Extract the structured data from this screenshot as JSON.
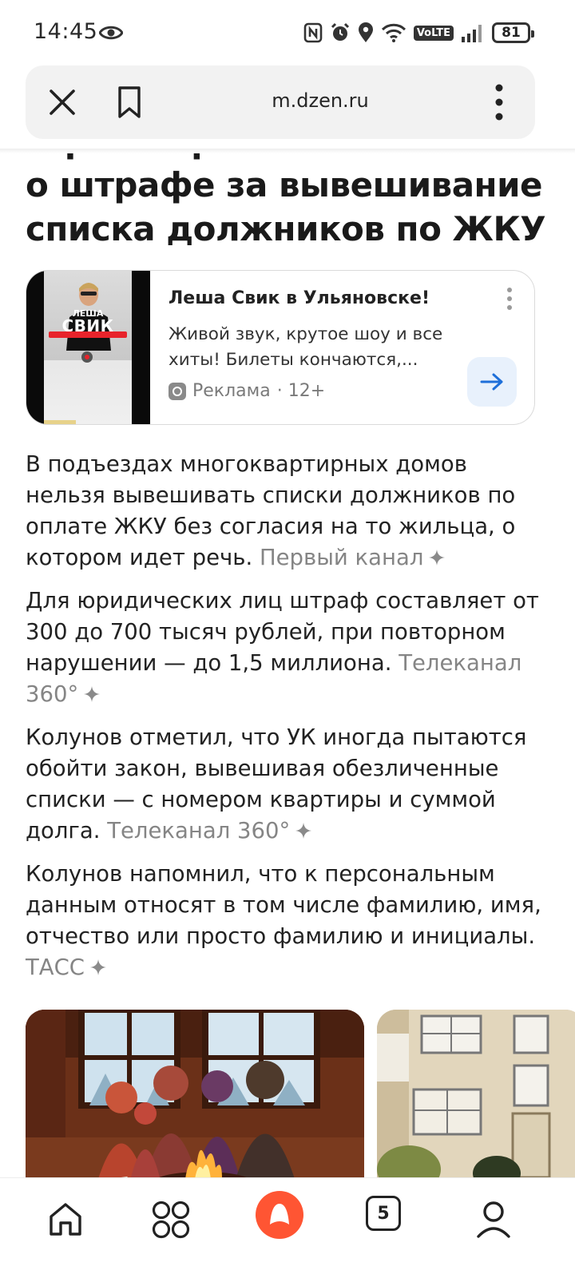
{
  "status_bar": {
    "time": "14:45",
    "volte": "VoLTE",
    "battery": "81"
  },
  "toolbar": {
    "url": "m.dzen.ru"
  },
  "article": {
    "title_lines": [
      "Юристы рассказали",
      "о штрафе за вывешивание",
      "списка должников по ЖКУ"
    ]
  },
  "ad": {
    "poster_small": "ЛЕША",
    "poster_big": "СВИК",
    "title": "Леша Свик в Ульяновске!",
    "description": "Живой звук, крутое шоу и все хиты! Билеты кончаются,...",
    "label": "Реклама",
    "age": "· 12+"
  },
  "paragraphs": [
    {
      "text": "В подъездах многоквартирных домов нельзя вывешивать списки должников по оплате ЖКУ без согласия на то жильца, о котором идет речь.",
      "source": "Первый канал"
    },
    {
      "text": "Для юридических лиц штраф составляет от 300 до 700 тысяч рублей, при повторном нарушении — до 1,5 миллиона.",
      "source": "Телеканал 360°"
    },
    {
      "text": "Колунов отметил, что УК иногда пытаются обойти закон, вывешивая обезличенные списки — с номером квартиры и суммой долга.",
      "source": "Телеканал 360°"
    },
    {
      "text": "Колунов напомнил, что к персональным данным относят в том числе фамилию, имя, отчество или просто фамилию и инициалы.",
      "source": "ТАСС"
    }
  ],
  "bottom_nav": {
    "tabs_count": "5",
    "items": [
      "home-icon",
      "services-grid-icon",
      "alice-icon",
      "tabs-icon",
      "profile-icon"
    ]
  },
  "colors": {
    "accent_alice": "#ff5533",
    "link_blue": "#1e6fd9",
    "source_gray": "#858585"
  }
}
